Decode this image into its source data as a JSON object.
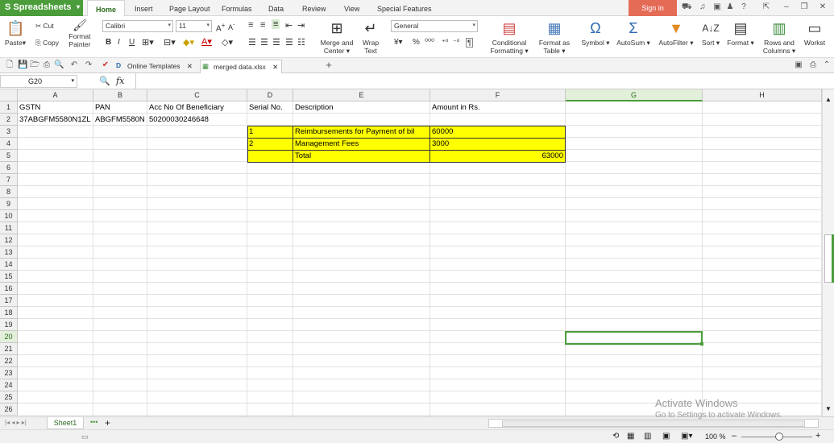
{
  "app": {
    "name": "Spreadsheets",
    "sign_in": "Sign in"
  },
  "menu_tabs": [
    "Home",
    "Insert",
    "Page Layout",
    "Formulas",
    "Data",
    "Review",
    "View",
    "Special Features"
  ],
  "ribbon": {
    "paste": "Paste",
    "cut": "Cut",
    "copy": "Copy",
    "format_painter_1": "Format",
    "format_painter_2": "Painter",
    "font_name": "Calibri",
    "font_size": "11",
    "bold": "B",
    "italic": "I",
    "underline": "U",
    "merge_1": "Merge and",
    "merge_2": "Center",
    "wrap_1": "Wrap",
    "wrap_2": "Text",
    "number_format": "General",
    "percent": "%",
    "conditional_1": "Conditional",
    "conditional_2": "Formatting",
    "format_table_1": "Format as",
    "format_table_2": "Table",
    "symbol": "Symbol",
    "autosum": "AutoSum",
    "autofilter": "AutoFilter",
    "sort": "Sort",
    "format": "Format",
    "rows_cols_1": "Rows and",
    "rows_cols_2": "Columns",
    "worksheet": "Workst"
  },
  "doc_tabs": [
    {
      "label": "Online Templates"
    },
    {
      "label": "merged data.xlsx"
    }
  ],
  "formula_bar": {
    "name_box": "G20",
    "fx": "fx",
    "content": ""
  },
  "columns": [
    "A",
    "B",
    "C",
    "D",
    "E",
    "F",
    "G",
    "H"
  ],
  "selected_column": "G",
  "rows": [
    "1",
    "2",
    "3",
    "4",
    "5",
    "6",
    "7",
    "8",
    "9",
    "10",
    "11",
    "12",
    "13",
    "14",
    "15",
    "16",
    "17",
    "18",
    "19",
    "20",
    "21",
    "22",
    "23",
    "24",
    "25",
    "26"
  ],
  "selected_row": "20",
  "cells": {
    "A1": "GSTN",
    "B1": "PAN",
    "C1": "Acc No Of Beneficiary",
    "D1": "Serial No.",
    "E1": "Description",
    "F1": "Amount in Rs.",
    "A2": "37ABGFM5580N1ZL",
    "B2": "ABGFM5580N",
    "C2": "50200030246648",
    "D3": "1",
    "E3": "Reimbursements for Payment of bil",
    "F3": "60000",
    "D4": "2",
    "E4": "Management Fees",
    "F4": "3000",
    "E5": "Total",
    "F5": "63000"
  },
  "highlight_color": "#ffff00",
  "accent_color": "#4a9d3a",
  "sheet_tabs": [
    {
      "label": "Sheet1"
    }
  ],
  "status": {
    "zoom": "100 %"
  },
  "watermark": {
    "line1": "Activate Windows",
    "line2": "Go to Settings to activate Windows."
  }
}
